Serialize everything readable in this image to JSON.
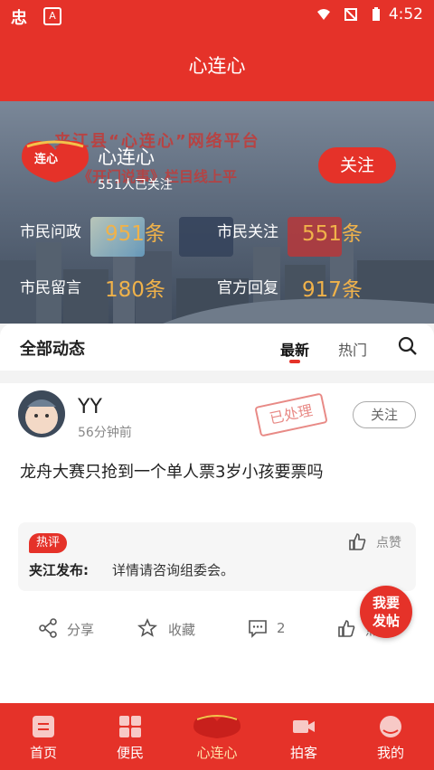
{
  "statusbar": {
    "time": "4:52"
  },
  "header": {
    "title": "心连心"
  },
  "profile": {
    "name": "心连心",
    "followers": "551人已关注",
    "follow_label": "关注",
    "banner_line1": "夹江县“心连心”网络平台",
    "banner_line2": "《开门说事》栏目线上平"
  },
  "stats": [
    {
      "label": "市民问政",
      "value": "951条"
    },
    {
      "label": "市民关注",
      "value": "551条"
    },
    {
      "label": "市民留言",
      "value": "180条"
    },
    {
      "label": "官方回复",
      "value": "917条"
    }
  ],
  "feed": {
    "title": "全部动态",
    "tabs": [
      "最新",
      "热门"
    ],
    "active_tab": "最新"
  },
  "post": {
    "user": "YY",
    "time": "56分钟前",
    "status": "已处理",
    "follow_label": "关注",
    "content": "龙舟大赛只抢到一个单人票3岁小孩要票吗",
    "hot_tag": "热评",
    "comment_author": "夹江发布:",
    "comment_text": "详情请咨询组委会。",
    "comment_like": "点赞",
    "actions": {
      "share": "分享",
      "collect": "收藏",
      "comments": "2",
      "like": "点赞"
    }
  },
  "fab": {
    "line1": "我要",
    "line2": "发帖"
  },
  "nav": [
    {
      "label": "首页"
    },
    {
      "label": "便民"
    },
    {
      "label": "心连心"
    },
    {
      "label": "拍客"
    },
    {
      "label": "我的"
    }
  ],
  "colors": {
    "brand": "#e53229",
    "stat_value": "#f0b24a"
  }
}
